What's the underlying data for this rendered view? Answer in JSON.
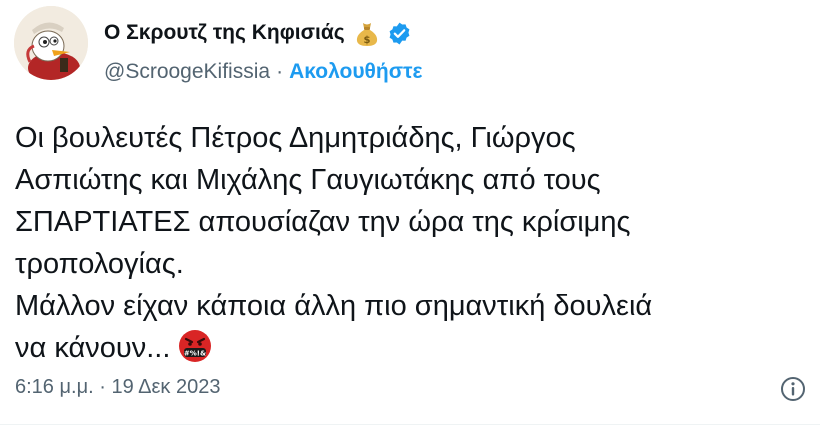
{
  "author": {
    "display_name": "Ο Σκρουτζ της Κηφισιάς",
    "handle": "@ScroogeKifissia",
    "separator": "·",
    "follow_label": "Ακολουθήστε",
    "avatar_icon": "scrooge-avatar",
    "name_emoji": "money-bag-icon",
    "verified_icon": "verified-badge-icon"
  },
  "tweet": {
    "lines": [
      "Οι βουλευτές Πέτρος Δημητριάδης, Γιώργος",
      "Ασπιώτης και Μιχάλης Γαυγιωτάκης από τους",
      "ΣΠΑΡΤΙΑΤΕΣ απουσίαζαν την ώρα της κρίσιμης",
      "τροπολογίας.",
      "Μάλλον είχαν κάποια άλλη πιο σημαντική δουλειά",
      "να κάνουν..."
    ],
    "trailing_emoji": "cursing-face-icon"
  },
  "meta": {
    "time": "6:16 μ.μ.",
    "separator": "·",
    "date": "19 Δεκ 2023",
    "info_icon": "info-icon"
  },
  "colors": {
    "text": "#0f1419",
    "secondary": "#536471",
    "accent": "#1d9bf0"
  }
}
